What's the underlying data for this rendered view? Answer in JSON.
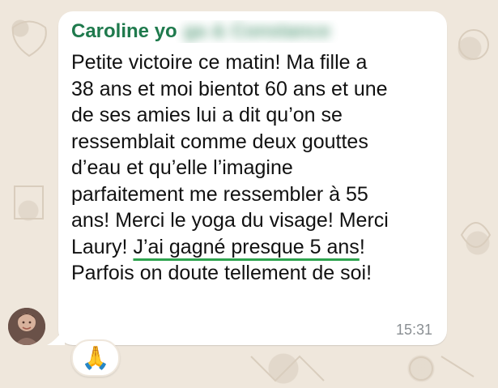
{
  "chat": {
    "sender_name": "Caroline yo",
    "sender_blurred": "ga & Constance",
    "message_lines": [
      "Petite victoire ce matin! Ma fille a",
      "38 ans et moi bientot 60 ans et une",
      "de ses amies lui a dit qu’on se",
      "ressemblait comme deux gouttes",
      "d’eau et qu’elle l’imagine",
      "parfaitement me ressembler à 55",
      "ans! Merci le yoga du visage! Merci",
      "Laury! ",
      "J’ai gagné presque 5 ans",
      "!",
      "Parfois on doute tellement de soi!"
    ],
    "time": "15:31",
    "reaction": "🙏",
    "accent_color": "#1f7a4d",
    "underline_color": "#2ea44f"
  },
  "icons": {
    "avatar": "avatar",
    "reaction": "folded-hands-icon"
  }
}
